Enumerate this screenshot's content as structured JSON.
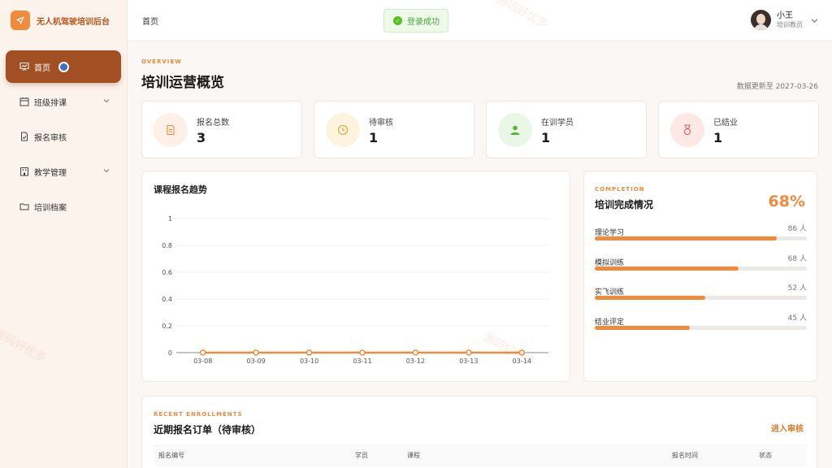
{
  "brand": {
    "title": "无人机驾驶培训后台"
  },
  "sidebar": {
    "items": [
      {
        "label": "首页",
        "icon": "dashboard-icon",
        "active": true
      },
      {
        "label": "班级排课",
        "icon": "calendar-icon",
        "expandable": true
      },
      {
        "label": "报名审核",
        "icon": "document-check-icon"
      },
      {
        "label": "教学管理",
        "icon": "building-icon",
        "expandable": true
      },
      {
        "label": "培训档案",
        "icon": "folder-icon"
      }
    ]
  },
  "header": {
    "breadcrumb": "首页",
    "toast": "登录成功",
    "user": {
      "name": "小王",
      "role": "培训教员"
    }
  },
  "overview": {
    "eyebrow": "OVERVIEW",
    "title": "培训运营概览",
    "updated": "数据更新至 2027-03-26"
  },
  "stats": [
    {
      "label": "报名总数",
      "value": "3",
      "icon": "document-icon",
      "color": "#f28a3c",
      "bg": "#fdf0e6"
    },
    {
      "label": "待审核",
      "value": "1",
      "icon": "clock-icon",
      "color": "#e3a12a",
      "bg": "#fdf4e0"
    },
    {
      "label": "在训学员",
      "value": "1",
      "icon": "user-icon",
      "color": "#52b43a",
      "bg": "#eaf7e6"
    },
    {
      "label": "已结业",
      "value": "1",
      "icon": "medal-icon",
      "color": "#e0604f",
      "bg": "#fce8e5"
    }
  ],
  "chart": {
    "title": "课程报名趋势"
  },
  "chart_data": {
    "type": "line",
    "title": "课程报名趋势",
    "x": [
      "03-08",
      "03-09",
      "03-10",
      "03-11",
      "03-12",
      "03-13",
      "03-14"
    ],
    "series": [
      {
        "values": [
          0,
          0,
          0,
          0,
          0,
          0,
          0
        ],
        "color": "#f28a3c"
      }
    ],
    "ylim": [
      0,
      1
    ],
    "yticks": [
      "0",
      "0.2",
      "0.4",
      "0.6",
      "0.8",
      "1"
    ],
    "xlabel": "",
    "ylabel": "",
    "grid": true
  },
  "completion": {
    "eyebrow": "COMPLETION",
    "title": "培训完成情况",
    "percent": "68%",
    "items": [
      {
        "label": "理论学习",
        "value": "86 人",
        "fraction": 0.86
      },
      {
        "label": "模拟训练",
        "value": "68 人",
        "fraction": 0.68
      },
      {
        "label": "实飞训练",
        "value": "52 人",
        "fraction": 0.52
      },
      {
        "label": "结业评定",
        "value": "45 人",
        "fraction": 0.45
      }
    ]
  },
  "recent": {
    "eyebrow": "RECENT ENROLLMENTS",
    "title": "近期报名订单（待审核）",
    "link": "进入审核",
    "columns": [
      "报名编号",
      "学员",
      "课程",
      "报名时间",
      "状态"
    ]
  },
  "watermark": "源码好优多"
}
